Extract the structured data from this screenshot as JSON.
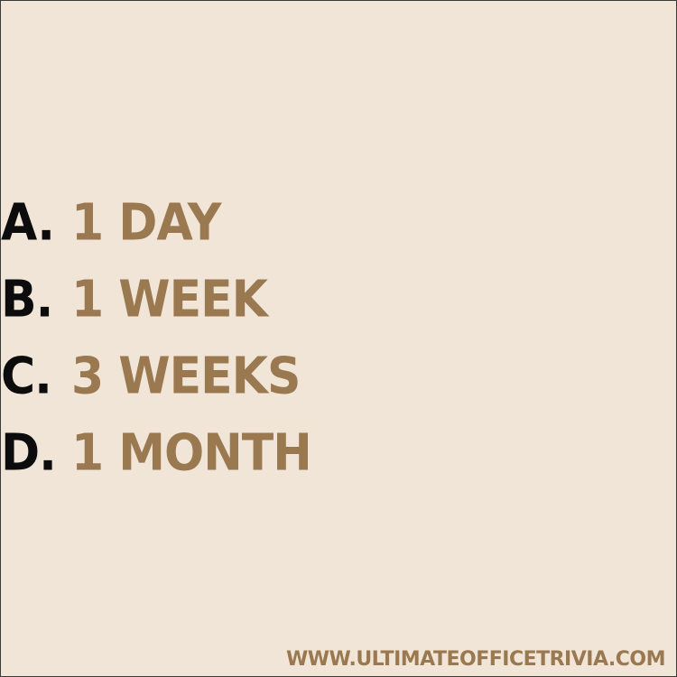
{
  "colors": {
    "background": "#f0e5d7",
    "letter": "#0c0c0c",
    "answer": "#9a7850",
    "border": "#3a3a3a"
  },
  "options": [
    {
      "letter": "A.",
      "text": "1 DAY"
    },
    {
      "letter": "B.",
      "text": "1 WEEK"
    },
    {
      "letter": "C.",
      "text": "3 WEEKS"
    },
    {
      "letter": "D.",
      "text": "1 MONTH"
    }
  ],
  "footer": {
    "url": "WWW.ULTIMATEOFFICETRIVIA.COM"
  }
}
